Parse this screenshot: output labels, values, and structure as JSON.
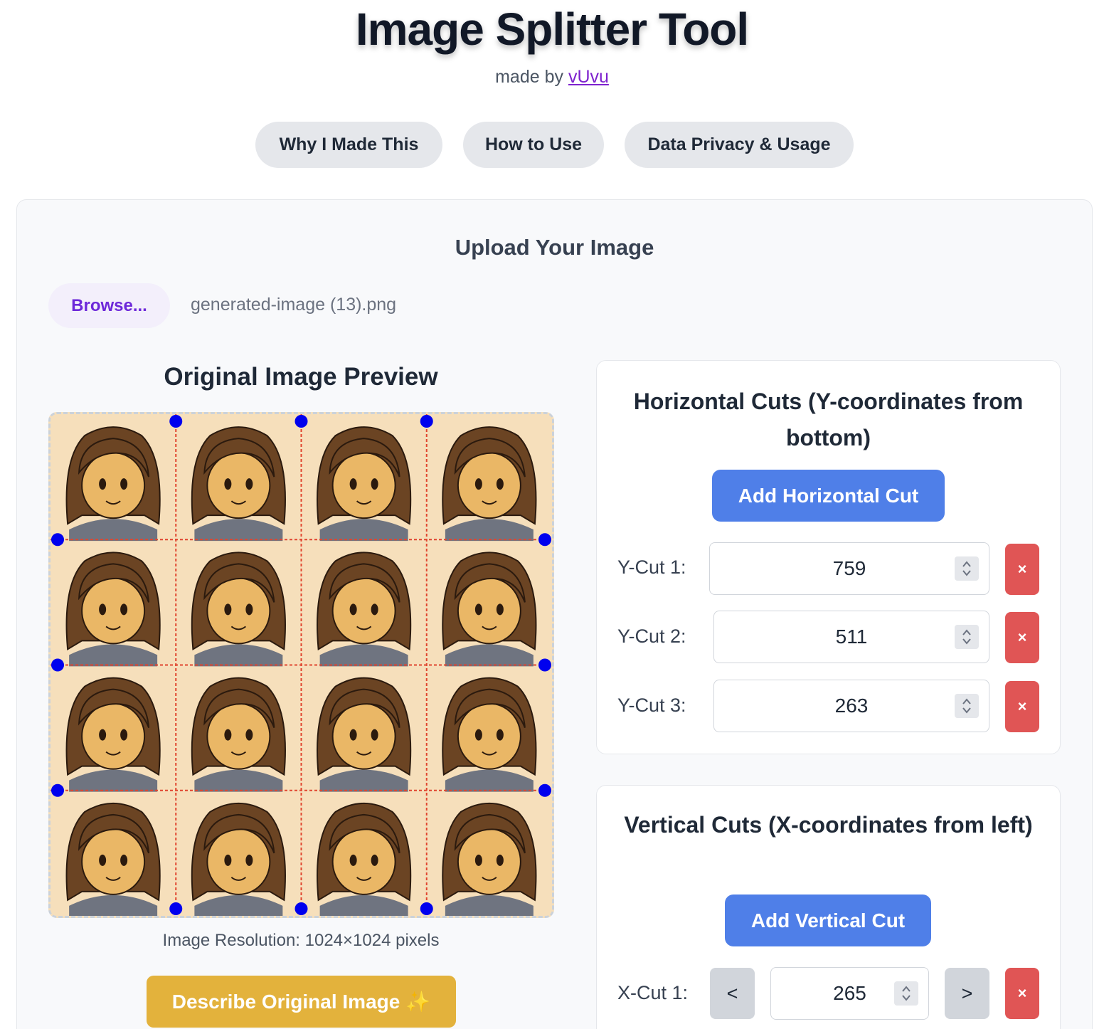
{
  "header": {
    "title": "Image Splitter Tool",
    "made_by": "made by",
    "author": "vUvu"
  },
  "nav": [
    {
      "label": "Why I Made This"
    },
    {
      "label": "How to Use"
    },
    {
      "label": "Data Privacy & Usage"
    }
  ],
  "upload": {
    "heading": "Upload Your Image",
    "browse_label": "Browse...",
    "filename": "generated-image (13).png"
  },
  "preview": {
    "heading": "Original Image Preview",
    "resolution": "Image Resolution: 1024×1024 pixels",
    "describe_label": "Describe Original Image",
    "describe_icon": "✨",
    "grid": {
      "rows": 4,
      "cols": 4
    },
    "colors": {
      "cell_bg": "#f6dfbb",
      "cut_line": "#e0452f",
      "handle": "#0000ee"
    }
  },
  "horizontal_cuts": {
    "heading": "Horizontal Cuts (Y-coordinates from bottom)",
    "add_label": "Add Horizontal Cut",
    "items": [
      {
        "label": "Y-Cut 1:",
        "value": "759",
        "delete": "×"
      },
      {
        "label": "Y-Cut 2:",
        "value": "511",
        "delete": "×"
      },
      {
        "label": "Y-Cut 3:",
        "value": "263",
        "delete": "×"
      }
    ]
  },
  "vertical_cuts": {
    "heading": "Vertical Cuts (X-coordinates from left)",
    "add_label": "Add Vertical Cut",
    "items": [
      {
        "label": "X-Cut 1:",
        "value": "265",
        "prev": "<",
        "next": ">",
        "delete": "×"
      }
    ]
  },
  "colors": {
    "accent_blue": "#4f7fe8",
    "danger_red": "#e05555",
    "describe_gold": "#e3b23c",
    "link_purple": "#7e22ce"
  }
}
